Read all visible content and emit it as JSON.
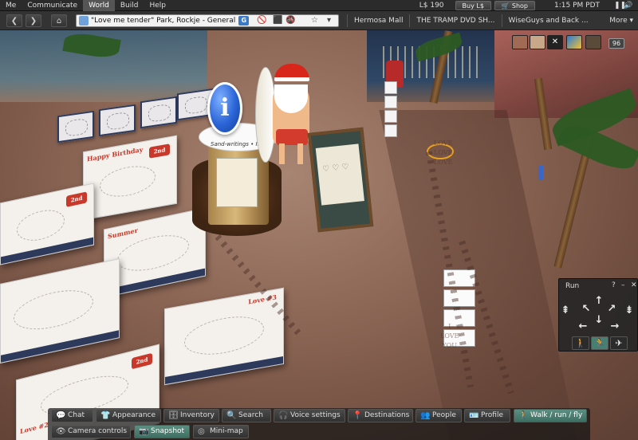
{
  "menubar": {
    "items": [
      "Me",
      "Communicate",
      "World",
      "Build",
      "Help"
    ],
    "active_index": 2,
    "balance": "L$ 190",
    "buy_label": "Buy L$",
    "shop_label": "Shop",
    "clock": "1:15 PM PDT",
    "pause_icon": "pause-icon",
    "audio_icon": "speaker-icon"
  },
  "navbar": {
    "location": "\"Love me tender\" Park, Rockje - General",
    "location_badge": "G",
    "favorites": [
      "Hermosa Mall",
      "THE TRAMP DVD SH...",
      "WiseGuys and Back ..."
    ],
    "more_label": "More ▾"
  },
  "hud": {
    "count": "96"
  },
  "world_text": {
    "column_caption": "Sand-writings • Inform",
    "card1_head": "Happy Birthday",
    "card3_head": "Summer",
    "card5_tag": "Love #3",
    "card6_head": "Love #2",
    "edition_tag": "2nd EDITION",
    "sand1": "LOVE\nLOVE\nLOVE",
    "sand2": "I\nLOVE\nYOU"
  },
  "run_panel": {
    "title": "Run",
    "help": "?",
    "minimize": "–",
    "close": "✕",
    "modes": [
      "walk",
      "run",
      "fly"
    ],
    "selected_mode": "run"
  },
  "toolbar": {
    "row1": [
      {
        "label": "Chat",
        "icon": "chat-icon"
      },
      {
        "label": "Appearance",
        "icon": "shirt-icon"
      },
      {
        "label": "Inventory",
        "icon": "inventory-icon"
      },
      {
        "label": "Search",
        "icon": "search-icon"
      },
      {
        "label": "Voice settings",
        "icon": "headset-icon"
      },
      {
        "label": "Destinations",
        "icon": "pin-icon"
      },
      {
        "label": "People",
        "icon": "people-icon"
      },
      {
        "label": "Profile",
        "icon": "profile-icon"
      },
      {
        "label": "Walk / run / fly",
        "icon": "walk-icon",
        "selected": true
      }
    ],
    "row2": [
      {
        "label": "Camera controls",
        "icon": "eye-icon"
      },
      {
        "label": "Snapshot",
        "icon": "camera-icon",
        "selected": true
      },
      {
        "label": "Mini-map",
        "icon": "minimap-icon"
      }
    ]
  }
}
